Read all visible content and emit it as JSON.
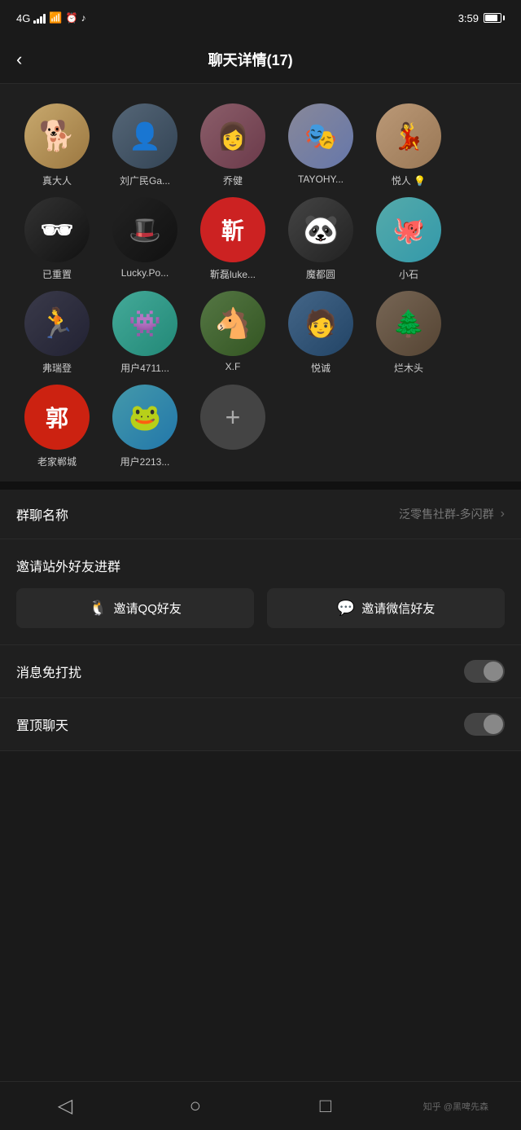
{
  "statusBar": {
    "signal": "4G",
    "battery": "81%",
    "time": "3:59"
  },
  "header": {
    "backLabel": "‹",
    "title": "聊天详情(17)"
  },
  "members": [
    {
      "id": 1,
      "name": "真大人",
      "avatarType": "dog",
      "avatarText": "🐕"
    },
    {
      "id": 2,
      "name": "刘广民Ga...",
      "avatarType": "man",
      "avatarText": "👤"
    },
    {
      "id": 3,
      "name": "乔健",
      "avatarType": "girl",
      "avatarText": "👩"
    },
    {
      "id": 4,
      "name": "TAYOHY...",
      "avatarType": "lady",
      "avatarText": "🎭"
    },
    {
      "id": 5,
      "name": "悦人 💡",
      "avatarType": "woman",
      "avatarText": "💃"
    },
    {
      "id": 6,
      "name": "已重置",
      "avatarType": "hat",
      "avatarText": "🕶"
    },
    {
      "id": 7,
      "name": "Lucky.Po...",
      "avatarType": "lucky",
      "avatarText": "🎩"
    },
    {
      "id": 8,
      "name": "靳磊luke...",
      "avatarType": "jin",
      "avatarText": "靳"
    },
    {
      "id": 9,
      "name": "魔都圆",
      "avatarType": "bear",
      "avatarText": "🐼"
    },
    {
      "id": 10,
      "name": "小石",
      "avatarType": "teal",
      "avatarText": "🐙"
    },
    {
      "id": 11,
      "name": "弗瑞登",
      "avatarType": "runner",
      "avatarText": "🏃"
    },
    {
      "id": 12,
      "name": "用户4711...",
      "avatarType": "monster",
      "avatarText": "👾"
    },
    {
      "id": 13,
      "name": "X.F",
      "avatarType": "horse",
      "avatarText": "🐴"
    },
    {
      "id": 14,
      "name": "悦诚",
      "avatarType": "yue",
      "avatarText": "🧑"
    },
    {
      "id": 15,
      "name": "烂木头",
      "avatarType": "wood",
      "avatarText": "🌲"
    },
    {
      "id": 16,
      "name": "老家郸城",
      "avatarType": "guo",
      "avatarText": "郭"
    },
    {
      "id": 17,
      "name": "用户2213...",
      "avatarType": "frog",
      "avatarText": "🐸"
    }
  ],
  "addButton": "+",
  "settings": {
    "groupName": {
      "label": "群聊名称",
      "value": "泛零售社群-多闪群"
    },
    "invite": {
      "title": "邀请站外好友进群",
      "qqLabel": "邀请QQ好友",
      "wechatLabel": "邀请微信好友"
    },
    "doNotDisturb": {
      "label": "消息免打扰",
      "enabled": false
    },
    "pinToTop": {
      "label": "置顶聊天",
      "enabled": false
    }
  },
  "bottomNav": {
    "back": "◁",
    "home": "○",
    "recent": "□",
    "credit": "知乎 @黑啤先森"
  }
}
